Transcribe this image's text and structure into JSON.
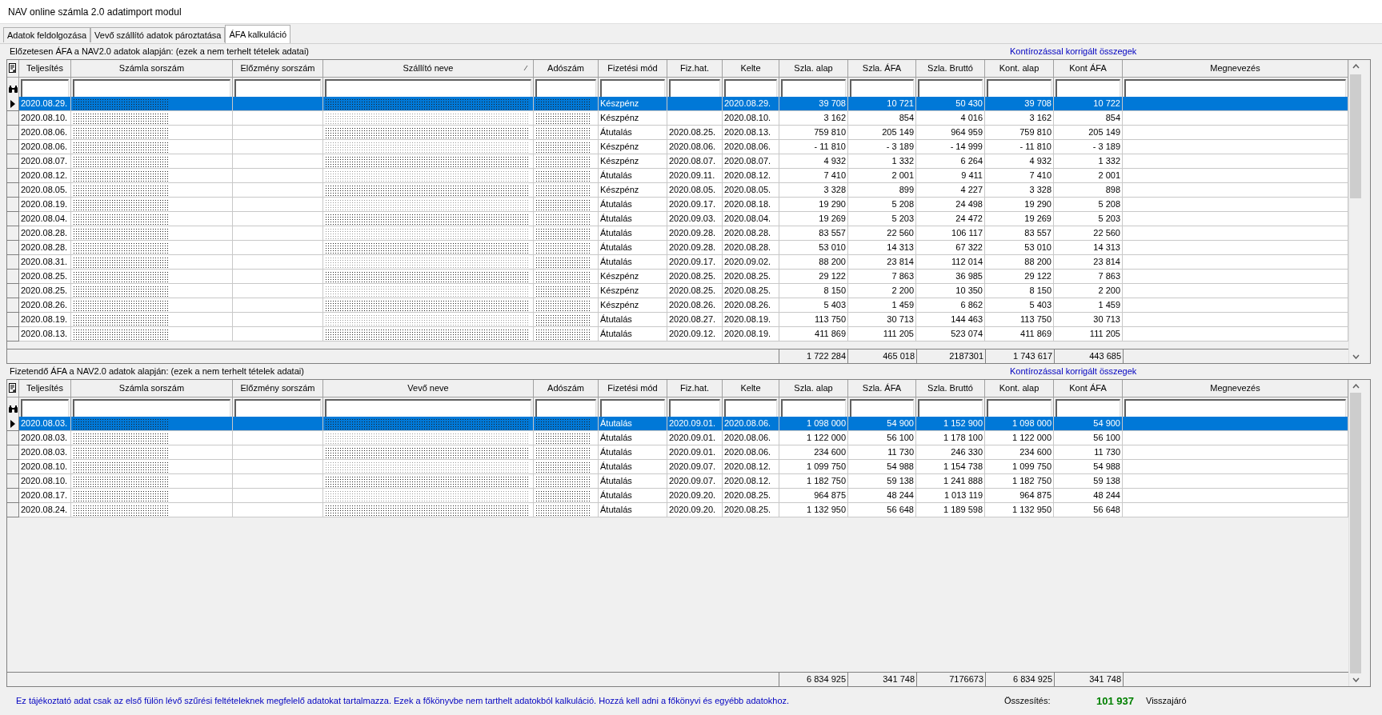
{
  "window": {
    "title": "NAV online számla 2.0 adatimport modul"
  },
  "tabs": [
    {
      "label": "Adatok feldolgozása",
      "selected": false
    },
    {
      "label": "Vevő szállító adatok pároztatása",
      "selected": false
    },
    {
      "label": "ÁFA kalkuláció",
      "selected": true
    }
  ],
  "sections": [
    {
      "caption": "Előzetesen ÁFA a NAV2.0 adatok alapján: (ezek a nem terhelt tételek adatai)",
      "note": "Kontírozással korrigált összegek",
      "columns": [
        {
          "label": "Teljesítés",
          "sorted": false
        },
        {
          "label": "Számla sorszám",
          "sorted": false
        },
        {
          "label": "Előzmény sorszám",
          "sorted": false
        },
        {
          "label": "Szállító neve",
          "sorted": true
        },
        {
          "label": "Adószám",
          "sorted": false
        },
        {
          "label": "Fizetési mód",
          "sorted": false
        },
        {
          "label": "Fiz.hat.",
          "sorted": false
        },
        {
          "label": "Kelte",
          "sorted": false
        },
        {
          "label": "Szla. alap",
          "sorted": false
        },
        {
          "label": "Szla. ÁFA",
          "sorted": false
        },
        {
          "label": "Szla. Bruttó",
          "sorted": false
        },
        {
          "label": "Kont. alap",
          "sorted": false
        },
        {
          "label": "Kont ÁFA",
          "sorted": false
        },
        {
          "label": "Megnevezés",
          "sorted": false
        }
      ],
      "rows": [
        {
          "selected": true,
          "date": "2020.08.29.",
          "method": "Készpénz",
          "issued": "2020.08.29.",
          "values": [
            "39 708",
            "10 721",
            "50 430",
            "39 708",
            "10 722"
          ]
        },
        {
          "selected": false,
          "date": "2020.08.10.",
          "method": "Készpénz",
          "issued": "2020.08.10.",
          "values": [
            "3 162",
            "854",
            "4 016",
            "3 162",
            "854"
          ]
        },
        {
          "selected": false,
          "date": "2020.08.06.",
          "method": "Átutalás",
          "due": "2020.08.25.",
          "issued": "2020.08.13.",
          "values": [
            "759 810",
            "205 149",
            "964 959",
            "759 810",
            "205 149"
          ]
        },
        {
          "selected": false,
          "date": "2020.08.06.",
          "method": "Készpénz",
          "due": "2020.08.06.",
          "issued": "2020.08.06.",
          "values": [
            "- 11 810",
            "- 3 189",
            "- 14 999",
            "- 11 810",
            "- 3 189"
          ]
        },
        {
          "selected": false,
          "date": "2020.08.07.",
          "method": "Készpénz",
          "due": "2020.08.07.",
          "issued": "2020.08.07.",
          "values": [
            "4 932",
            "1 332",
            "6 264",
            "4 932",
            "1 332"
          ]
        },
        {
          "selected": false,
          "date": "2020.08.12.",
          "method": "Átutalás",
          "due": "2020.09.11.",
          "issued": "2020.08.12.",
          "values": [
            "7 410",
            "2 001",
            "9 411",
            "7 410",
            "2 001"
          ]
        },
        {
          "selected": false,
          "date": "2020.08.05.",
          "method": "Készpénz",
          "due": "2020.08.05.",
          "issued": "2020.08.05.",
          "values": [
            "3 328",
            "899",
            "4 227",
            "3 328",
            "898"
          ]
        },
        {
          "selected": false,
          "date": "2020.08.19.",
          "method": "Átutalás",
          "due": "2020.09.17.",
          "issued": "2020.08.18.",
          "values": [
            "19 290",
            "5 208",
            "24 498",
            "19 290",
            "5 208"
          ]
        },
        {
          "selected": false,
          "date": "2020.08.04.",
          "method": "Átutalás",
          "due": "2020.09.03.",
          "issued": "2020.08.04.",
          "values": [
            "19 269",
            "5 203",
            "24 472",
            "19 269",
            "5 203"
          ]
        },
        {
          "selected": false,
          "date": "2020.08.28.",
          "method": "Átutalás",
          "due": "2020.09.28.",
          "issued": "2020.08.28.",
          "values": [
            "83 557",
            "22 560",
            "106 117",
            "83 557",
            "22 560"
          ]
        },
        {
          "selected": false,
          "date": "2020.08.28.",
          "method": "Átutalás",
          "due": "2020.09.28.",
          "issued": "2020.08.28.",
          "values": [
            "53 010",
            "14 313",
            "67 322",
            "53 010",
            "14 313"
          ]
        },
        {
          "selected": false,
          "date": "2020.08.31.",
          "method": "Átutalás",
          "due": "2020.09.17.",
          "issued": "2020.09.02.",
          "values": [
            "88 200",
            "23 814",
            "112 014",
            "88 200",
            "23 814"
          ]
        },
        {
          "selected": false,
          "date": "2020.08.25.",
          "method": "Készpénz",
          "due": "2020.08.25.",
          "issued": "2020.08.25.",
          "values": [
            "29 122",
            "7 863",
            "36 985",
            "29 122",
            "7 863"
          ]
        },
        {
          "selected": false,
          "date": "2020.08.25.",
          "method": "Készpénz",
          "due": "2020.08.25.",
          "issued": "2020.08.25.",
          "values": [
            "8 150",
            "2 200",
            "10 350",
            "8 150",
            "2 200"
          ]
        },
        {
          "selected": false,
          "date": "2020.08.26.",
          "method": "Készpénz",
          "due": "2020.08.26.",
          "issued": "2020.08.26.",
          "values": [
            "5 403",
            "1 459",
            "6 862",
            "5 403",
            "1 459"
          ]
        },
        {
          "selected": false,
          "date": "2020.08.19.",
          "method": "Átutalás",
          "due": "2020.08.27.",
          "issued": "2020.08.19.",
          "values": [
            "113 750",
            "30 713",
            "144 463",
            "113 750",
            "30 713"
          ]
        },
        {
          "selected": false,
          "date": "2020.08.13.",
          "method": "Átutalás",
          "due": "2020.09.12.",
          "issued": "2020.08.19.",
          "values": [
            "411 869",
            "111 205",
            "523 074",
            "411 869",
            "111 205"
          ]
        }
      ],
      "totals": [
        "1 722 284",
        "465 018",
        "2187301",
        "1 743 617",
        "443 685"
      ]
    },
    {
      "caption": "Fizetendő ÁFA a NAV2.0 adatok alapján: (ezek a nem terhelt tételek adatai)",
      "note": "Kontírozással korrigált összegek",
      "columns": [
        {
          "label": "Teljesítés",
          "sorted": false
        },
        {
          "label": "Számla sorszám",
          "sorted": false
        },
        {
          "label": "Előzmény sorszám",
          "sorted": false
        },
        {
          "label": "Vevő neve",
          "sorted": false
        },
        {
          "label": "Adószám",
          "sorted": false
        },
        {
          "label": "Fizetési mód",
          "sorted": false
        },
        {
          "label": "Fiz.hat.",
          "sorted": false
        },
        {
          "label": "Kelte",
          "sorted": false
        },
        {
          "label": "Szla. alap",
          "sorted": false
        },
        {
          "label": "Szla. ÁFA",
          "sorted": false
        },
        {
          "label": "Szla. Bruttó",
          "sorted": false
        },
        {
          "label": "Kont. alap",
          "sorted": false
        },
        {
          "label": "Kont ÁFA",
          "sorted": false
        },
        {
          "label": "Megnevezés",
          "sorted": false
        }
      ],
      "rows": [
        {
          "selected": true,
          "date": "2020.08.03.",
          "method": "Átutalás",
          "due": "2020.09.01.",
          "issued": "2020.08.06.",
          "values": [
            "1 098 000",
            "54 900",
            "1 152 900",
            "1 098 000",
            "54 900"
          ]
        },
        {
          "selected": false,
          "date": "2020.08.03.",
          "method": "Átutalás",
          "due": "2020.09.01.",
          "issued": "2020.08.06.",
          "values": [
            "1 122 000",
            "56 100",
            "1 178 100",
            "1 122 000",
            "56 100"
          ]
        },
        {
          "selected": false,
          "date": "2020.08.03.",
          "method": "Átutalás",
          "due": "2020.09.01.",
          "issued": "2020.08.06.",
          "values": [
            "234 600",
            "11 730",
            "246 330",
            "234 600",
            "11 730"
          ]
        },
        {
          "selected": false,
          "date": "2020.08.10.",
          "method": "Átutalás",
          "due": "2020.09.07.",
          "issued": "2020.08.12.",
          "values": [
            "1 099 750",
            "54 988",
            "1 154 738",
            "1 099 750",
            "54 988"
          ]
        },
        {
          "selected": false,
          "date": "2020.08.10.",
          "method": "Átutalás",
          "due": "2020.09.07.",
          "issued": "2020.08.12.",
          "values": [
            "1 182 750",
            "59 138",
            "1 241 888",
            "1 182 750",
            "59 138"
          ]
        },
        {
          "selected": false,
          "date": "2020.08.17.",
          "method": "Átutalás",
          "due": "2020.09.20.",
          "issued": "2020.08.25.",
          "values": [
            "964 875",
            "48 244",
            "1 013 119",
            "964 875",
            "48 244"
          ]
        },
        {
          "selected": false,
          "date": "2020.08.24.",
          "method": "Átutalás",
          "due": "2020.09.20.",
          "issued": "2020.08.25.",
          "values": [
            "1 132 950",
            "56 648",
            "1 189 598",
            "1 132 950",
            "56 648"
          ]
        }
      ],
      "totals": [
        "6 834 925",
        "341 748",
        "7176673",
        "6 834 925",
        "341 748"
      ]
    }
  ],
  "footer": {
    "info": "Ez tájékoztató adat csak az első fülön lévő szűrési feltételeknek megfelelő adatokat tartalmazza. Ezek a főkönyvbe nem tarthelt adatokból kalkuláció. Hozzá kell adni a főkönyvi és egyébb adatokhoz.",
    "summary_label": "Összesítés:",
    "summary_value": "101 937",
    "summary_note": "Visszajáró"
  }
}
